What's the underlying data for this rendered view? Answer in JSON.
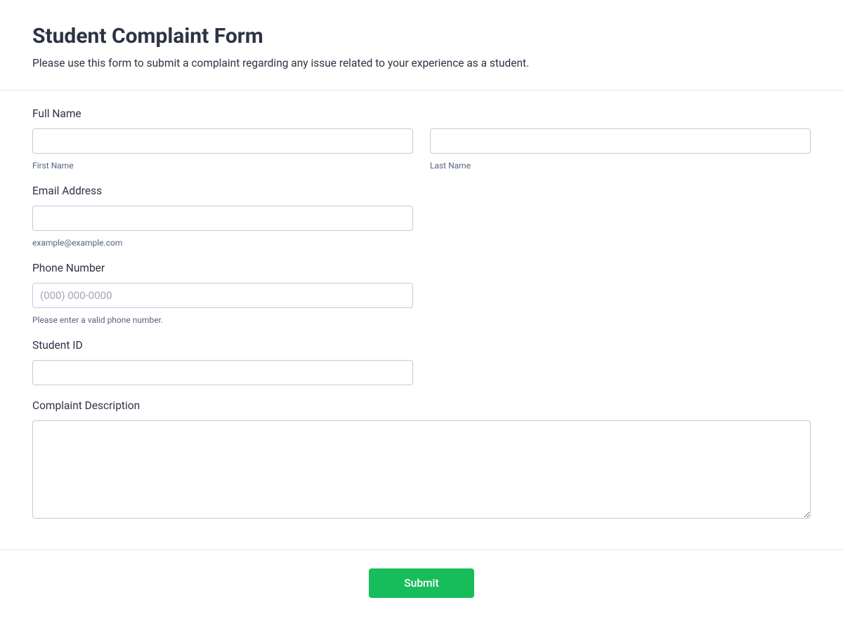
{
  "header": {
    "title": "Student Complaint Form",
    "subtitle": "Please use this form to submit a complaint regarding any issue related to your experience as a student."
  },
  "fields": {
    "full_name": {
      "label": "Full Name",
      "first_sub": "First Name",
      "last_sub": "Last Name"
    },
    "email": {
      "label": "Email Address",
      "sub": "example@example.com"
    },
    "phone": {
      "label": "Phone Number",
      "placeholder": "(000) 000-0000",
      "sub": "Please enter a valid phone number."
    },
    "student_id": {
      "label": "Student ID"
    },
    "complaint": {
      "label": "Complaint Description"
    }
  },
  "submit_label": "Submit"
}
